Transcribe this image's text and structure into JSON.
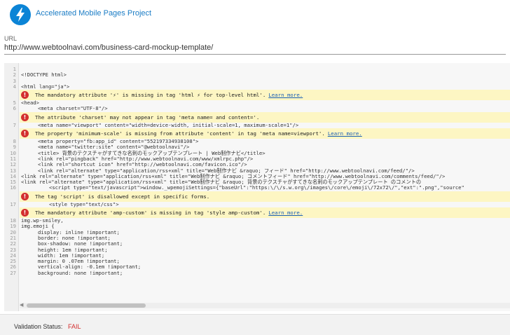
{
  "header": {
    "title": "Accelerated Mobile Pages Project",
    "logo_icon": "lightning-bolt-icon",
    "logo_color": "#0b84d6"
  },
  "url": {
    "label": "URL",
    "value": "http://www.webtoolnavi.com/business-card-mockup-template/"
  },
  "source_blocks": [
    {
      "type": "line",
      "n": "1",
      "text": "",
      "indent": 0
    },
    {
      "type": "line",
      "n": "2",
      "text": "<!DOCTYPE html>",
      "indent": 0
    },
    {
      "type": "line",
      "n": "3",
      "text": "",
      "indent": 0
    },
    {
      "type": "line",
      "n": "4",
      "text": "<html lang=\"ja\">",
      "indent": 0
    },
    {
      "type": "error",
      "text": "The mandatory attribute '⚡' is missing in tag 'html ⚡ for top-level html'.",
      "link": "Learn more."
    },
    {
      "type": "line",
      "n": "5",
      "text": "<head>",
      "indent": 0
    },
    {
      "type": "line",
      "n": "6",
      "text": "<meta charset=\"UTF-8\"/>",
      "indent": 1
    },
    {
      "type": "error",
      "text": "The attribute 'charset' may not appear in tag 'meta name= and content='.",
      "link": ""
    },
    {
      "type": "line",
      "n": "7",
      "text": "<meta name=\"viewport\" content=\"width=device-width, initial-scale=1, maximum-scale=1\"/>",
      "indent": 1
    },
    {
      "type": "error",
      "text": "The property 'minimum-scale' is missing from attribute 'content' in tag 'meta name=viewport'.",
      "link": "Learn more."
    },
    {
      "type": "line",
      "n": "8",
      "text": "<meta property=\"fb:app_id\" content=\"552197334938108\">",
      "indent": 1
    },
    {
      "type": "line",
      "n": "9",
      "text": "<meta name=\"twitter:site\" content=\"@webtoolnavi\"/>",
      "indent": 1
    },
    {
      "type": "line",
      "n": "10",
      "text": "<title> 背景のテクスチャがすてきな名刺のモックアップテンプレート | Web制作ナビ</title>",
      "indent": 1
    },
    {
      "type": "line",
      "n": "11",
      "text": "<link rel=\"pingback\" href=\"http://www.webtoolnavi.com/www/xmlrpc.php\"/>",
      "indent": 1
    },
    {
      "type": "line",
      "n": "12",
      "text": "<link rel=\"shortcut icon\" href=\"http://webtoolnavi.com/favicon.ico\"/>",
      "indent": 1
    },
    {
      "type": "line",
      "n": "13",
      "text": "<link rel=\"alternate\" type=\"application/rss+xml\" title=\"Web制作ナビ &raquo; フィード\" href=\"http://www.webtoolnavi.com/feed/\"/>",
      "indent": 1
    },
    {
      "type": "line",
      "n": "14",
      "text": "<link rel=\"alternate\" type=\"application/rss+xml\" title=\"Web制作ナビ &raquo; コメントフィード\" href=\"http://www.webtoolnavi.com/comments/feed/\"/>",
      "indent": 0
    },
    {
      "type": "line",
      "n": "15",
      "text": "<link rel=\"alternate\" type=\"application/rss+xml\" title=\"Web制作ナビ &raquo; 背景のテクスチャがすてきな名刺のモックアップテンプレート のコメントの",
      "indent": 0
    },
    {
      "type": "line",
      "n": "16",
      "text": "<script type=\"text/javascript\">window._wpemojiSettings={\"baseUrl\":\"https:\\/\\/s.w.org\\/images\\/core\\/emoji\\/72x72\\/\",\"ext\":\".png\",\"source\"",
      "indent": 2
    },
    {
      "type": "error",
      "text": "The tag 'script' is disallowed except in specific forms.",
      "link": ""
    },
    {
      "type": "line",
      "n": "17",
      "text": "<style type=\"text/css\">",
      "indent": 2
    },
    {
      "type": "error",
      "text": "The mandatory attribute 'amp-custom' is missing in tag 'style amp-custom'.",
      "link": "Learn more."
    },
    {
      "type": "line",
      "n": "18",
      "text": "img.wp-smiley,",
      "indent": 0
    },
    {
      "type": "line",
      "n": "19",
      "text": "img.emoji {",
      "indent": 0
    },
    {
      "type": "line",
      "n": "20",
      "text": "display: inline !important;",
      "indent": 1
    },
    {
      "type": "line",
      "n": "21",
      "text": "border: none !important;",
      "indent": 1
    },
    {
      "type": "line",
      "n": "22",
      "text": "box-shadow: none !important;",
      "indent": 1
    },
    {
      "type": "line",
      "n": "23",
      "text": "height: 1em !important;",
      "indent": 1
    },
    {
      "type": "line",
      "n": "24",
      "text": "width: 1em !important;",
      "indent": 1
    },
    {
      "type": "line",
      "n": "25",
      "text": "margin: 0 .07em !important;",
      "indent": 1
    },
    {
      "type": "line",
      "n": "26",
      "text": "vertical-align: -0.1em !important;",
      "indent": 1
    },
    {
      "type": "line",
      "n": "27",
      "text": "background: none !important;",
      "indent": 1
    }
  ],
  "error_icon": "exclamation-circle-icon",
  "error_color": "#d32f2f",
  "error_bg": "#fdf6c3",
  "footer": {
    "status_label": "Validation Status:",
    "status_value": "FAIL"
  }
}
